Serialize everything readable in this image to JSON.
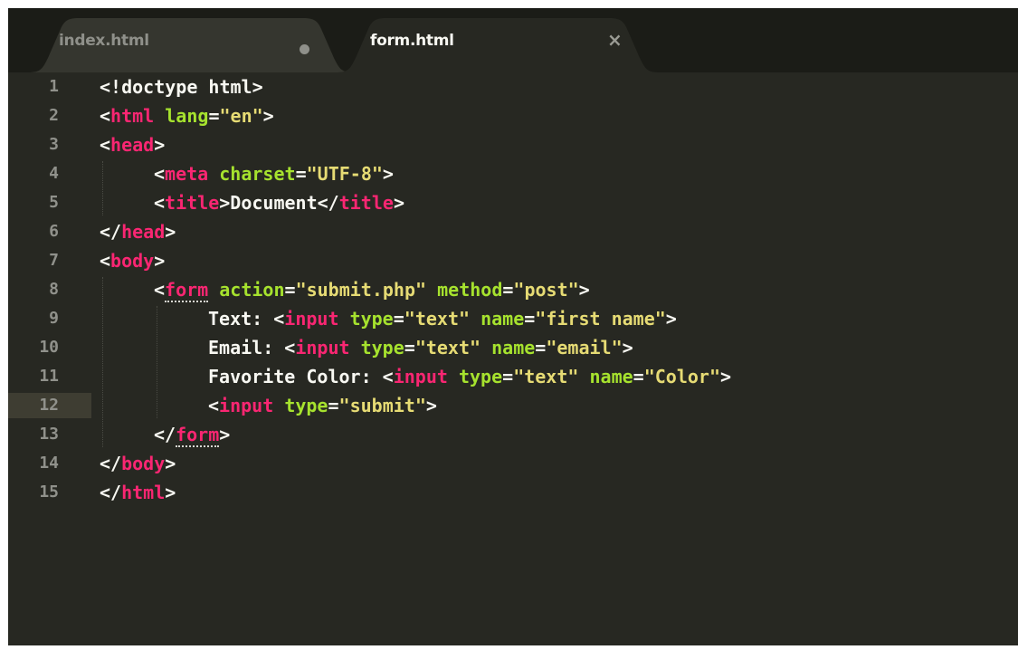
{
  "tabs": [
    {
      "label": "index.html",
      "active": false,
      "modified": true
    },
    {
      "label": "form.html",
      "active": true,
      "close_glyph": "×"
    }
  ],
  "current_line": 12,
  "code": [
    {
      "n": "1",
      "indent": 0,
      "tokens": [
        [
          "p",
          "<!doctype html>"
        ]
      ]
    },
    {
      "n": "2",
      "indent": 0,
      "tokens": [
        [
          "p",
          "<"
        ],
        [
          "t",
          "html"
        ],
        [
          "p",
          " "
        ],
        [
          "a",
          "lang"
        ],
        [
          "p",
          "="
        ],
        [
          "s",
          "\"en\""
        ],
        [
          "p",
          ">"
        ]
      ]
    },
    {
      "n": "3",
      "indent": 0,
      "tokens": [
        [
          "p",
          "<"
        ],
        [
          "t",
          "head"
        ],
        [
          "p",
          ">"
        ]
      ]
    },
    {
      "n": "4",
      "indent": 1,
      "tokens": [
        [
          "p",
          "<"
        ],
        [
          "t",
          "meta"
        ],
        [
          "p",
          " "
        ],
        [
          "a",
          "charset"
        ],
        [
          "p",
          "="
        ],
        [
          "s",
          "\"UTF-8\""
        ],
        [
          "p",
          ">"
        ]
      ]
    },
    {
      "n": "5",
      "indent": 1,
      "tokens": [
        [
          "p",
          "<"
        ],
        [
          "t",
          "title"
        ],
        [
          "p",
          ">Document</"
        ],
        [
          "t",
          "title"
        ],
        [
          "p",
          ">"
        ]
      ]
    },
    {
      "n": "6",
      "indent": 0,
      "tokens": [
        [
          "p",
          "</"
        ],
        [
          "t",
          "head"
        ],
        [
          "p",
          ">"
        ]
      ]
    },
    {
      "n": "7",
      "indent": 0,
      "tokens": [
        [
          "p",
          "<"
        ],
        [
          "t",
          "body"
        ],
        [
          "p",
          ">"
        ]
      ]
    },
    {
      "n": "8",
      "indent": 1,
      "tokens": [
        [
          "p",
          "<"
        ],
        [
          "t",
          "form"
        ],
        [
          "p",
          " "
        ],
        [
          "a",
          "action"
        ],
        [
          "p",
          "="
        ],
        [
          "s",
          "\"submit.php\""
        ],
        [
          "p",
          " "
        ],
        [
          "a",
          "method"
        ],
        [
          "p",
          "="
        ],
        [
          "s",
          "\"post\""
        ],
        [
          "p",
          ">"
        ]
      ]
    },
    {
      "n": "9",
      "indent": 2,
      "tokens": [
        [
          "p",
          "Text: <"
        ],
        [
          "t",
          "input"
        ],
        [
          "p",
          " "
        ],
        [
          "a",
          "type"
        ],
        [
          "p",
          "="
        ],
        [
          "s",
          "\"text\""
        ],
        [
          "p",
          " "
        ],
        [
          "a",
          "name"
        ],
        [
          "p",
          "="
        ],
        [
          "s",
          "\"first name\""
        ],
        [
          "p",
          ">"
        ]
      ]
    },
    {
      "n": "10",
      "indent": 2,
      "tokens": [
        [
          "p",
          "Email: <"
        ],
        [
          "t",
          "input"
        ],
        [
          "p",
          " "
        ],
        [
          "a",
          "type"
        ],
        [
          "p",
          "="
        ],
        [
          "s",
          "\"text\""
        ],
        [
          "p",
          " "
        ],
        [
          "a",
          "name"
        ],
        [
          "p",
          "="
        ],
        [
          "s",
          "\"email\""
        ],
        [
          "p",
          ">"
        ]
      ]
    },
    {
      "n": "11",
      "indent": 2,
      "tokens": [
        [
          "p",
          "Favorite Color: <"
        ],
        [
          "t",
          "input"
        ],
        [
          "p",
          " "
        ],
        [
          "a",
          "type"
        ],
        [
          "p",
          "="
        ],
        [
          "s",
          "\"text\""
        ],
        [
          "p",
          " "
        ],
        [
          "a",
          "name"
        ],
        [
          "p",
          "="
        ],
        [
          "s",
          "\"Color\""
        ],
        [
          "p",
          ">"
        ]
      ]
    },
    {
      "n": "12",
      "indent": 2,
      "tokens": [
        [
          "p",
          "<"
        ],
        [
          "t",
          "input"
        ],
        [
          "p",
          " "
        ],
        [
          "a",
          "type"
        ],
        [
          "p",
          "="
        ],
        [
          "s",
          "\"submit\""
        ],
        [
          "p",
          ">"
        ]
      ]
    },
    {
      "n": "13",
      "indent": 1,
      "tokens": [
        [
          "p",
          "</"
        ],
        [
          "t",
          "form"
        ],
        [
          "p",
          ">"
        ]
      ]
    },
    {
      "n": "14",
      "indent": 0,
      "tokens": [
        [
          "p",
          "</"
        ],
        [
          "t",
          "body"
        ],
        [
          "p",
          ">"
        ]
      ]
    },
    {
      "n": "15",
      "indent": 0,
      "tokens": [
        [
          "p",
          "</"
        ],
        [
          "t",
          "html"
        ],
        [
          "p",
          ">"
        ]
      ]
    }
  ],
  "colors": {
    "background": "#272822",
    "tag": "#f92672",
    "attribute": "#a6e22e",
    "string": "#e6db74",
    "text": "#f8f8f2",
    "line_number": "#90918b",
    "current_line_highlight": "#3e3d32"
  }
}
